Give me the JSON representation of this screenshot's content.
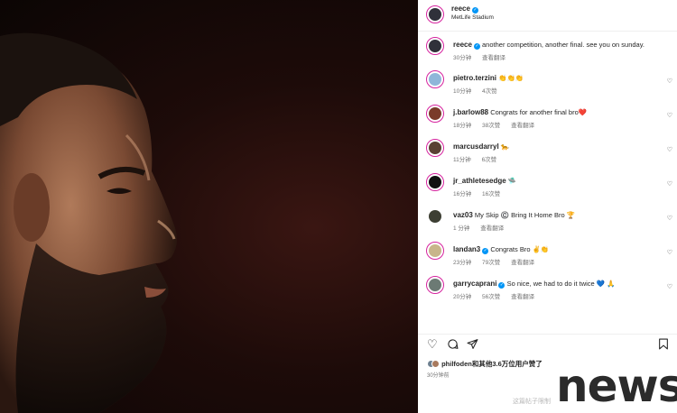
{
  "post": {
    "username": "reece",
    "location": "MetLife Stadium",
    "caption_user": "reece",
    "caption": "another competition, another final. see you on sunday.",
    "caption_time": "30分钟",
    "caption_translate": "查看翻译"
  },
  "comments": [
    {
      "user": "pietro.terzini",
      "verified": false,
      "text": "👏👏👏",
      "time": "10分钟",
      "likes": "4次赞",
      "translate": "",
      "avatar_color": "#8fb6d9"
    },
    {
      "user": "j.barlow88",
      "verified": false,
      "text": "Congrats for another final bro❤️",
      "time": "18分钟",
      "likes": "38次赞",
      "translate": "查看翻译",
      "avatar_color": "#7a3b2a"
    },
    {
      "user": "marcusdarryl",
      "verified": false,
      "text": "🐆",
      "time": "11分钟",
      "likes": "6次赞",
      "translate": "",
      "avatar_color": "#5a4234"
    },
    {
      "user": "jr_athletesedge",
      "verified": false,
      "text": "🛸",
      "time": "16分钟",
      "likes": "16次赞",
      "translate": "",
      "avatar_color": "#111111"
    },
    {
      "user": "vaz03",
      "verified": false,
      "text": "My Skip ©️ Bring It Home Bro 🏆",
      "time": "1 分钟",
      "likes": "",
      "translate": "查看翻译",
      "avatar_color": "#3d3f33"
    },
    {
      "user": "landan3",
      "verified": true,
      "text": "Congrats Bro ✌️👏",
      "time": "23分钟",
      "likes": "79次赞",
      "translate": "查看翻译",
      "avatar_color": "#c8b58a"
    },
    {
      "user": "garrycaprani",
      "verified": true,
      "text": "So nice, we had to do it twice 💙 🙏",
      "time": "20分钟",
      "likes": "56次赞",
      "translate": "查看翻译",
      "avatar_color": "#6c7a74"
    }
  ],
  "likes_line": {
    "user": "philfoden",
    "rest": "和其他3.6万位用户赞了"
  },
  "post_time": "30分钟前",
  "watermark": "这篇帖子限制",
  "logo_text": "news",
  "icons": {
    "like": "heart-icon",
    "comment": "comment-icon",
    "share": "share-icon",
    "save": "bookmark-icon"
  },
  "colors": {
    "verified": "#0095f6",
    "story_ring": "#d6249f",
    "meta_text": "#737373"
  }
}
